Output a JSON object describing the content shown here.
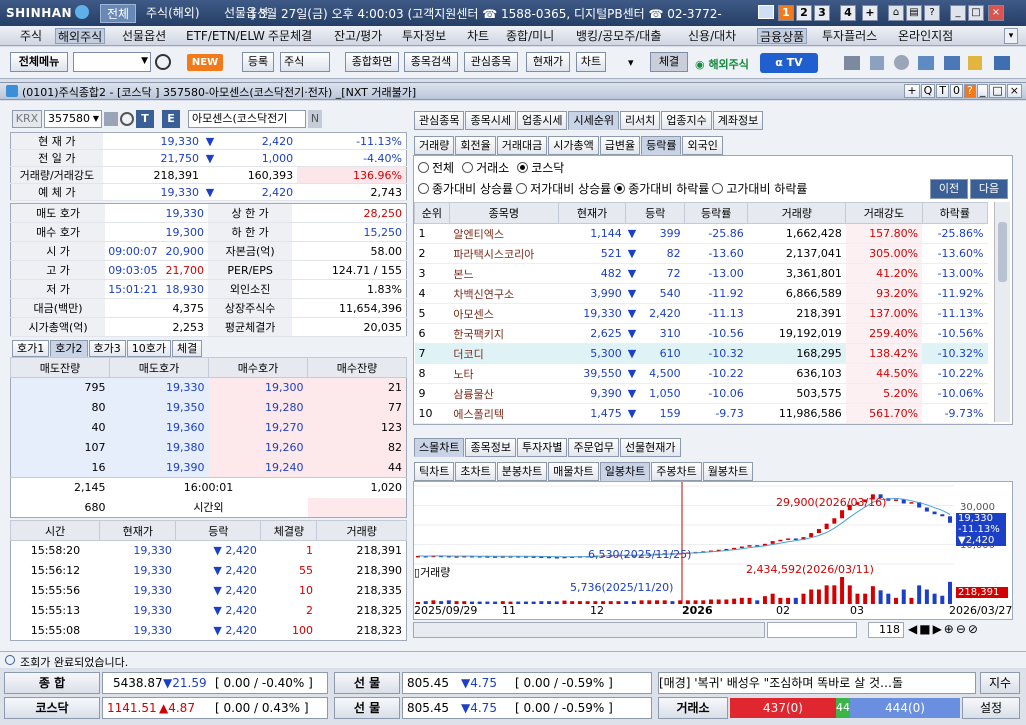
{
  "topbar": {
    "logo": "SHINHAN",
    "tabs": [
      "전체",
      "주식(해외)",
      "선물옵션"
    ],
    "clock": "] 3월 27일(금) 오후 4:00:03 (고객지원센터 ☎ 1588-0365, 디지털PB센터 ☎ 02-3772-",
    "num_buttons": [
      "1",
      "2",
      "3",
      "4",
      "+"
    ],
    "win_buttons": [
      "⌂",
      "▤",
      "?",
      "_",
      "□",
      "×"
    ]
  },
  "menu": [
    "주식",
    "해외주식",
    "선물옵션",
    "ETF/ETN/ELW",
    "주문체결",
    "잔고/평가",
    "투자정보",
    "차트",
    "종합/미니",
    "뱅킹/공모주/대출",
    "신용/대차",
    "금융상품",
    "투자플러스",
    "온라인지점"
  ],
  "toolbar": {
    "all_menu": "전체메뉴",
    "new_badge": "NEW",
    "buttons": [
      "등록",
      "주식",
      "종합화면",
      "종목검색",
      "관심종목",
      "현재가",
      "차트"
    ],
    "chejyul": "체결",
    "overseas": "해외주식",
    "tv": "TV"
  },
  "window": {
    "title": "(0101)주식종합2 - [코스닥 ] 357580-아모센스(코스닥전기·전자) _[NXT 거래불가]",
    "buttons": [
      "+",
      "Q",
      "T",
      "0",
      "?",
      "_",
      "□",
      "×"
    ]
  },
  "stock": {
    "market": "KRX",
    "code": "357580",
    "name": "아모센스(코스닥전기",
    "badge_t": "T",
    "badge_e": "E",
    "badge_n": "N"
  },
  "quote": {
    "rows1": [
      {
        "label": "현 재 가",
        "v1": "19,330",
        "arrow": "▼",
        "v2": "2,420",
        "v3": "-11.13%"
      },
      {
        "label": "전 일 가",
        "v1": "21,750",
        "arrow": "▼",
        "v2": "1,000",
        "v3": "-4.40%"
      },
      {
        "label": "거래량/거래강도",
        "v1": "218,391",
        "arrow": "",
        "v2": "160,393",
        "v3": "136.96%"
      },
      {
        "label": "예 체 가",
        "v1": "19,330",
        "arrow": "▼",
        "v2": "2,420",
        "v3": "2,743"
      }
    ],
    "rows2": [
      {
        "label": "매도 호가",
        "v1": "19,330",
        "l2": "상 한 가",
        "v2": "28,250"
      },
      {
        "label": "매수 호가",
        "v1": "19,300",
        "l2": "하 한 가",
        "v2": "15,250"
      },
      {
        "label": "시 가",
        "t": "09:00:07",
        "v1": "20,900",
        "l2": "자본금(억)",
        "v2": "58.00"
      },
      {
        "label": "고 가",
        "t": "09:03:05",
        "v1": "21,700",
        "l2": "PER/EPS",
        "v2": "124.71 / 155"
      },
      {
        "label": "저 가",
        "t": "15:01:21",
        "v1": "18,930",
        "l2": "외인소진",
        "v2": "1.83%"
      },
      {
        "label": "대금(백만)",
        "v1": "4,375",
        "l2": "상장주식수",
        "v2": "11,654,396"
      },
      {
        "label": "시가총액(억)",
        "v1": "2,253",
        "l2": "평균체결가",
        "v2": "20,035"
      }
    ]
  },
  "orderbook": {
    "tabs": [
      "호가1",
      "호가2",
      "호가3",
      "10호가",
      "체결"
    ],
    "headers": [
      "매도잔량",
      "매도호가",
      "매수호가",
      "매수잔량"
    ],
    "rows": [
      {
        "ask_qty": "795",
        "ask": "19,330",
        "bid": "19,300",
        "bid_qty": "21"
      },
      {
        "ask_qty": "80",
        "ask": "19,350",
        "bid": "19,280",
        "bid_qty": "77"
      },
      {
        "ask_qty": "40",
        "ask": "19,360",
        "bid": "19,270",
        "bid_qty": "123"
      },
      {
        "ask_qty": "107",
        "ask": "19,380",
        "bid": "19,260",
        "bid_qty": "82"
      },
      {
        "ask_qty": "16",
        "ask": "19,390",
        "bid": "19,240",
        "bid_qty": "44"
      }
    ],
    "total_ask": "2,145",
    "time": "16:00:01",
    "total_bid": "1,020",
    "after_qty": "680",
    "after_label": "시간외"
  },
  "trades": {
    "headers": [
      "시간",
      "현재가",
      "등락",
      "체결량",
      "거래량"
    ],
    "rows": [
      {
        "t": "15:58:20",
        "p": "19,330",
        "c": "2,420",
        "q": "1",
        "v": "218,391"
      },
      {
        "t": "15:56:12",
        "p": "19,330",
        "c": "2,420",
        "q": "55",
        "v": "218,390"
      },
      {
        "t": "15:55:56",
        "p": "19,330",
        "c": "2,420",
        "q": "10",
        "v": "218,335"
      },
      {
        "t": "15:55:13",
        "p": "19,330",
        "c": "2,420",
        "q": "2",
        "v": "218,325"
      },
      {
        "t": "15:55:08",
        "p": "19,330",
        "c": "2,420",
        "q": "100",
        "v": "218,323"
      }
    ]
  },
  "right": {
    "tabs1": [
      "관심종목",
      "종목시세",
      "업종시세",
      "시세순위",
      "리서치",
      "업종지수",
      "계좌정보"
    ],
    "tabs2": [
      "거래량",
      "회전율",
      "거래대금",
      "시가총액",
      "급변율",
      "등락률",
      "외국인"
    ],
    "market_radios": [
      "전체",
      "거래소",
      "코스닥"
    ],
    "sort_radios": [
      "종가대비 상승률",
      "저가대비 상승률",
      "종가대비 하락률",
      "고가대비 하락률"
    ],
    "prev": "이전",
    "next": "다음",
    "headers": [
      "순위",
      "종목명",
      "현재가",
      "등락",
      "등락률",
      "거래량",
      "거래강도",
      "하락률"
    ],
    "rows": [
      {
        "rank": "1",
        "name": "알엔티엑스",
        "price": "1,144",
        "chg": "399",
        "rate": "-25.86",
        "vol": "1,662,428",
        "str": "157.80%",
        "fall": "-25.86%"
      },
      {
        "rank": "2",
        "name": "파라택시스코리아",
        "price": "521",
        "chg": "82",
        "rate": "-13.60",
        "vol": "2,137,041",
        "str": "305.00%",
        "fall": "-13.60%"
      },
      {
        "rank": "3",
        "name": "본느",
        "price": "482",
        "chg": "72",
        "rate": "-13.00",
        "vol": "3,361,801",
        "str": "41.20%",
        "fall": "-13.00%"
      },
      {
        "rank": "4",
        "name": "차백신연구소",
        "price": "3,990",
        "chg": "540",
        "rate": "-11.92",
        "vol": "6,866,589",
        "str": "93.20%",
        "fall": "-11.92%"
      },
      {
        "rank": "5",
        "name": "아모센스",
        "price": "19,330",
        "chg": "2,420",
        "rate": "-11.13",
        "vol": "218,391",
        "str": "137.00%",
        "fall": "-11.13%"
      },
      {
        "rank": "6",
        "name": "한국팩키지",
        "price": "2,625",
        "chg": "310",
        "rate": "-10.56",
        "vol": "19,192,019",
        "str": "259.40%",
        "fall": "-10.56%"
      },
      {
        "rank": "7",
        "name": "더코디",
        "price": "5,300",
        "chg": "610",
        "rate": "-10.32",
        "vol": "168,295",
        "str": "138.42%",
        "fall": "-10.32%"
      },
      {
        "rank": "8",
        "name": "노타",
        "price": "39,550",
        "chg": "4,500",
        "rate": "-10.22",
        "vol": "636,103",
        "str": "44.50%",
        "fall": "-10.22%"
      },
      {
        "rank": "9",
        "name": "삼륭물산",
        "price": "9,390",
        "chg": "1,050",
        "rate": "-10.06",
        "vol": "503,575",
        "str": "5.20%",
        "fall": "-10.06%"
      },
      {
        "rank": "10",
        "name": "에스폴리텍",
        "price": "1,475",
        "chg": "159",
        "rate": "-9.73",
        "vol": "11,986,586",
        "str": "561.70%",
        "fall": "-9.73%"
      }
    ],
    "tabs3": [
      "스몰차트",
      "종목정보",
      "투자자별",
      "주문업무",
      "선물현재가"
    ],
    "tabs4": [
      "틱차트",
      "초차트",
      "분봉차트",
      "매물차트",
      "일봉차트",
      "주봉차트",
      "월봉차트"
    ]
  },
  "chart": {
    "high_label": "29,900(2026/03/16)",
    "low_label": "6,530(2025/11/25)",
    "y1": "30,000",
    "y2": "20,000",
    "y3": "10,000",
    "cur": "19,330",
    "cur_pct": "-11.13%",
    "cur_chg": "▼2,420",
    "vol_title": "거래량",
    "vol_high": "2,434,592(2026/03/11)",
    "vol_low": "5,736(2025/11/20)",
    "vol_cur": "218,391",
    "xlabels": [
      "2025/09/29",
      "11",
      "12",
      "2026",
      "02",
      "03",
      "2026/03/27"
    ],
    "zoom": "118"
  },
  "chart_data": {
    "type": "line",
    "price": [
      7000,
      6900,
      7100,
      7000,
      6800,
      6900,
      7000,
      6950,
      6900,
      6850,
      6800,
      6900,
      6950,
      6900,
      6850,
      6800,
      6700,
      6600,
      6530,
      6700,
      6800,
      6900,
      7000,
      7100,
      7200,
      7300,
      7400,
      7300,
      7200,
      7400,
      7600,
      7800,
      8000,
      7900,
      8100,
      8300,
      8500,
      8700,
      9000,
      9300,
      9600,
      10000,
      10500,
      11000,
      10800,
      11500,
      12500,
      13000,
      13500,
      13000,
      14000,
      15500,
      17000,
      19000,
      21000,
      24000,
      26000,
      27000,
      28000,
      29900,
      28500,
      27500,
      28000,
      26500,
      27000,
      25000,
      23500,
      22500,
      21750,
      19330
    ],
    "ylim": [
      4000,
      33000
    ]
  },
  "status": {
    "message": "조회가 완료되었습니다."
  },
  "tickers": {
    "row1": {
      "label": "종 합",
      "value": "5438.87",
      "chg": "▼21.59",
      "bracket": "[ 0.00 / -0.40% ]",
      "fut_label": "선 물",
      "fut_value": "805.45",
      "fut_chg": "▼4.75",
      "fut_bracket": "[ 0.00 / -0.59% ]",
      "news": "[매경] '복귀' 배성우 \"조심하며 똑바로 살 것…돌",
      "btn": "지수"
    },
    "row2": {
      "label": "코스닥",
      "value": "1141.51",
      "chg": "▲4.87",
      "bracket": "[ 0.00 / 0.43% ]",
      "fut_label": "선 물",
      "fut_value": "805.45",
      "fut_chg": "▼4.75",
      "fut_bracket": "[ 0.00 / -0.59% ]",
      "exch": "거래소",
      "red_val": "437(0)",
      "green_val": "44",
      "blue_val": "444(0)",
      "btn": "설정"
    }
  }
}
